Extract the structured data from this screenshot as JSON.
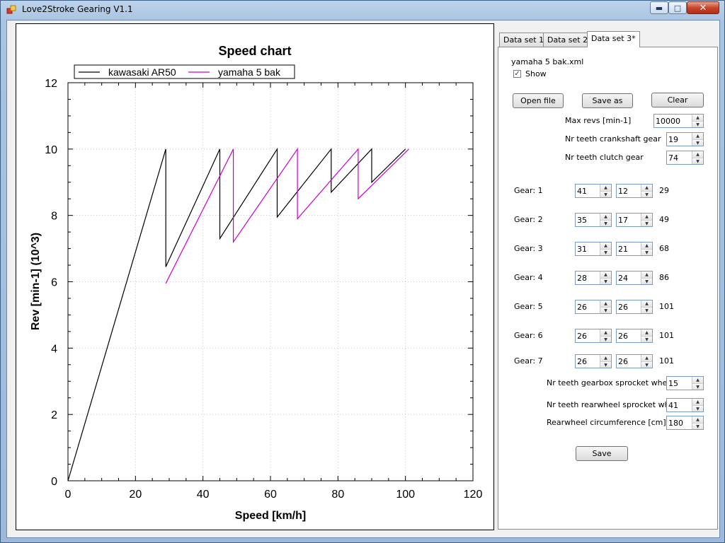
{
  "window": {
    "title": "Love2Stroke Gearing V1.1"
  },
  "tabs": [
    {
      "label": "Data set 1",
      "active": false
    },
    {
      "label": "Data set 2",
      "active": false
    },
    {
      "label": "Data set 3*",
      "active": true
    }
  ],
  "panel": {
    "file_name": "yamaha 5 bak.xml",
    "show_label": "Show",
    "show_checked": true,
    "open_file": "Open file",
    "save_as": "Save as",
    "clear": "Clear",
    "max_revs_label": "Max revs [min-1]",
    "max_revs": "10000",
    "crank_label": "Nr teeth crankshaft gear",
    "crank_teeth": "19",
    "clutch_label": "Nr teeth clutch gear",
    "clutch_teeth": "74",
    "gears": [
      {
        "label": "Gear: 1",
        "a": "41",
        "b": "12",
        "speed": "29"
      },
      {
        "label": "Gear: 2",
        "a": "35",
        "b": "17",
        "speed": "49"
      },
      {
        "label": "Gear: 3",
        "a": "31",
        "b": "21",
        "speed": "68"
      },
      {
        "label": "Gear: 4",
        "a": "28",
        "b": "24",
        "speed": "86"
      },
      {
        "label": "Gear: 5",
        "a": "26",
        "b": "26",
        "speed": "101"
      },
      {
        "label": "Gear: 6",
        "a": "26",
        "b": "26",
        "speed": "101"
      },
      {
        "label": "Gear: 7",
        "a": "26",
        "b": "26",
        "speed": "101"
      }
    ],
    "gearbox_sprocket_label": "Nr teeth gearbox sprocket wheel",
    "gearbox_sprocket": "15",
    "rear_sprocket_label": "Nr teeth rearwheel sprocket wheel",
    "rear_sprocket": "41",
    "circumference_label": "Rearwheel circumference [cm]",
    "circumference": "180",
    "save": "Save"
  },
  "chart_data": {
    "type": "line",
    "title": "Speed chart",
    "xlabel": "Speed [km/h]",
    "ylabel": "Rev [min-1] (10^3)",
    "xlim": [
      0,
      120
    ],
    "ylim": [
      0,
      12
    ],
    "xticks": [
      "0",
      "20",
      "40",
      "60",
      "80",
      "100",
      "120"
    ],
    "yticks": [
      "0",
      "2",
      "4",
      "6",
      "8",
      "10",
      "12"
    ],
    "grid": true,
    "legend": "top-left",
    "series": [
      {
        "name": "kawasaki AR50",
        "color": "#000000",
        "points": [
          [
            0,
            0
          ],
          [
            29,
            10
          ],
          [
            29,
            6.45
          ],
          [
            45,
            10
          ],
          [
            45,
            7.3
          ],
          [
            62,
            10
          ],
          [
            62,
            7.95
          ],
          [
            78,
            10
          ],
          [
            78,
            8.7
          ],
          [
            90,
            10
          ],
          [
            90,
            9.0
          ],
          [
            100,
            10
          ]
        ]
      },
      {
        "name": "yamaha 5 bak",
        "color": "#cc00cc",
        "points": [
          [
            29,
            5.95
          ],
          [
            49,
            10
          ],
          [
            49,
            7.2
          ],
          [
            68,
            10
          ],
          [
            68,
            7.9
          ],
          [
            86,
            10
          ],
          [
            86,
            8.5
          ],
          [
            101,
            10
          ]
        ]
      }
    ]
  }
}
